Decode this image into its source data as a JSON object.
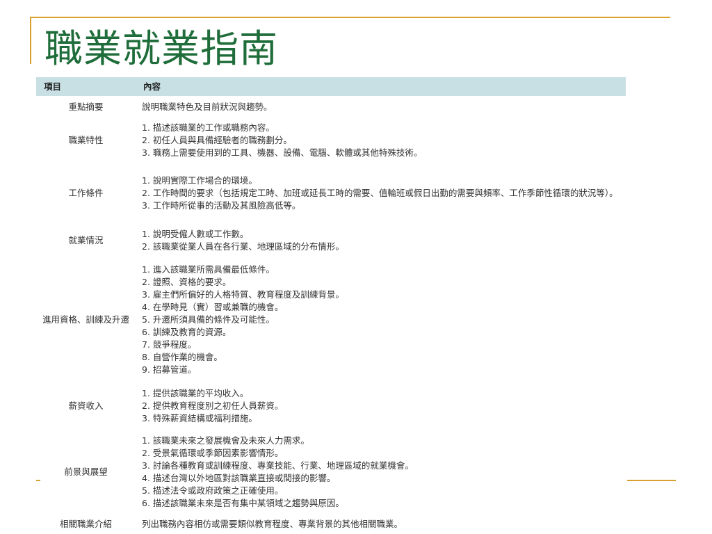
{
  "title": "職業就業指南",
  "table": {
    "headers": [
      "項目",
      "內容"
    ],
    "rows": [
      {
        "item": "重點摘要",
        "lines": [
          "說明職業特色及目前狀況與趨勢。"
        ]
      },
      {
        "item": "職業特性",
        "lines": [
          "1. 描述該職業的工作或職務內容。",
          "2. 初任人員與具備經驗者的職務劃分。",
          "3. 職務上需要使用到的工具、機器、設備、電腦、軟體或其他特殊技術。"
        ]
      },
      {
        "item": "工作條件",
        "lines": [
          "1. 說明實際工作場合的環境。",
          "2. 工作時間的要求（包括規定工時、加班或延長工時的需要、值輪班或假日出勤的需要與頻率、工作季節性循環的狀況等）。",
          "3. 工作時所從事的活動及其風險高低等。"
        ]
      },
      {
        "item": "就業情況",
        "lines": [
          "1. 說明受僱人數或工作數。",
          "2. 該職業從業人員在各行業、地理區域的分布情形。"
        ]
      },
      {
        "item": "進用資格、訓練及升遷",
        "lines": [
          "1. 進入該職業所需具備最低條件。",
          "2. 證照、資格的要求。",
          "3. 雇主們所偏好的人格特質、教育程度及訓練背景。",
          "4. 在學時見（實）習或兼職的機會。",
          "5. 升遷所須具備的條件及可能性。",
          "6. 訓練及教育的資源。",
          "7. 競爭程度。",
          "8. 自營作業的機會。",
          "9. 招募管道。"
        ]
      },
      {
        "item": "薪資收入",
        "lines": [
          "1. 提供該職業的平均收入。",
          "2. 提供教育程度別之初任人員薪資。",
          "3. 特殊薪資結構或福利措施。"
        ]
      },
      {
        "item": "前景與展望",
        "lines": [
          "1. 該職業未來之發展機會及未來人力需求。",
          "2. 受景氣循環或季節因素影響情形。",
          "3. 討論各種教育或訓練程度、專業技能、行業、地理區域的就業機會。",
          "4. 描述台灣以外地區對該職業直接或間接的影響。",
          "5. 描述法令或政府政策之正確使用。",
          "6. 描述該職業未來是否有集中某領域之趨勢與原因。"
        ]
      },
      {
        "item": "相關職業介紹",
        "lines": [
          "列出職務內容相仿或需要類似教育程度、專業背景的其他相關職業。"
        ]
      }
    ]
  },
  "colors": {
    "accent": "#d9a12c",
    "title": "#1f6d3a",
    "header_bg": "#c8e0e4"
  }
}
